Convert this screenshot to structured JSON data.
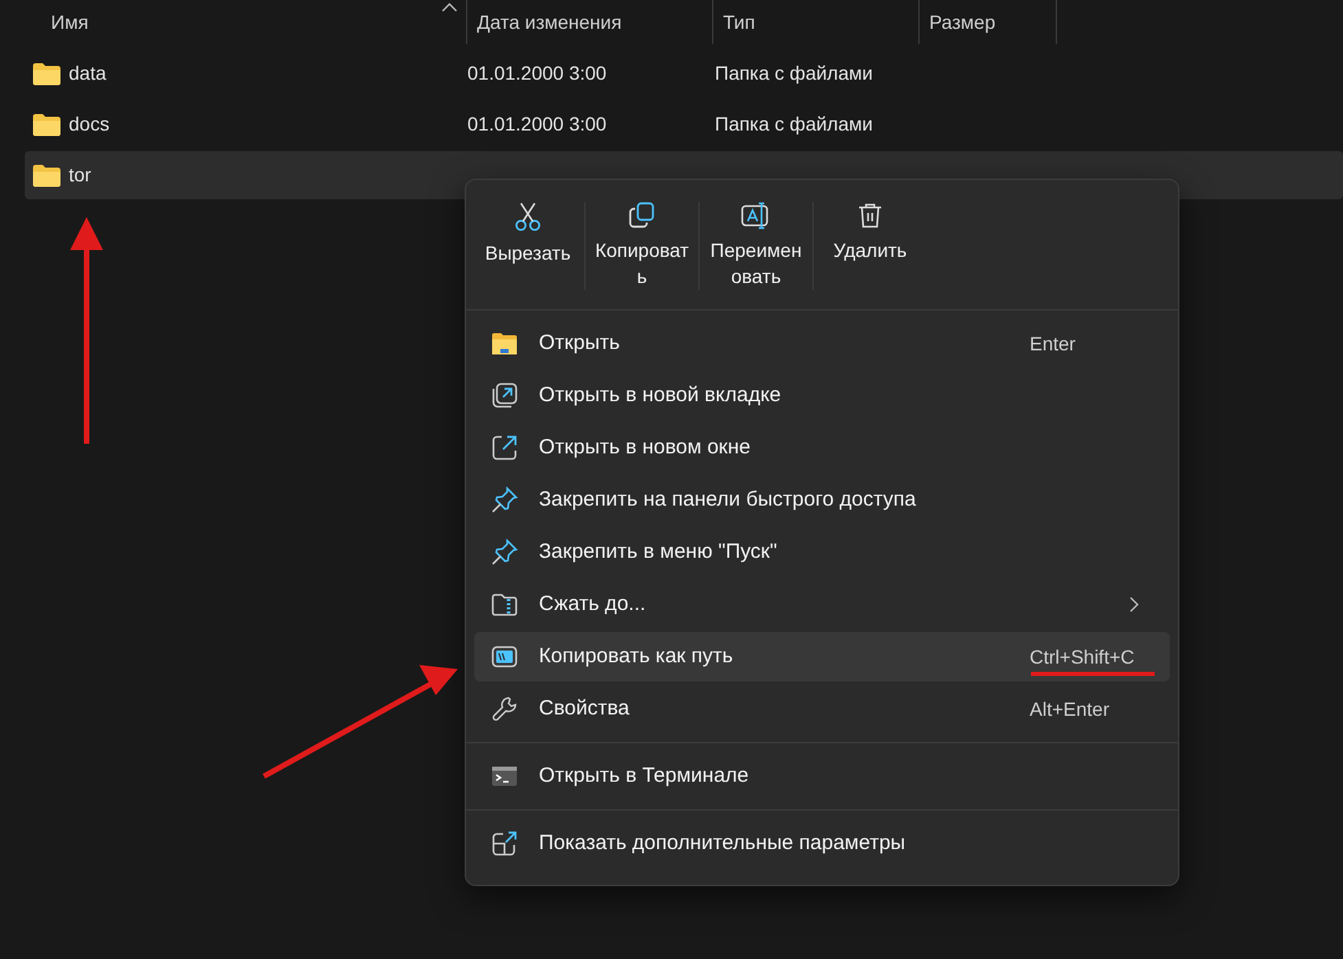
{
  "file_list": {
    "columns": [
      {
        "label": "Имя",
        "sorted": true
      },
      {
        "label": "Дата изменения",
        "sorted": false
      },
      {
        "label": "Тип",
        "sorted": false
      },
      {
        "label": "Размер",
        "sorted": false
      }
    ],
    "rows": [
      {
        "name": "data",
        "modified": "01.01.2000 3:00",
        "type": "Папка с файлами",
        "selected": false
      },
      {
        "name": "docs",
        "modified": "01.01.2000 3:00",
        "type": "Папка с файлами",
        "selected": false
      },
      {
        "name": "tor",
        "selected": true
      }
    ]
  },
  "context_menu": {
    "toolbar": [
      {
        "label": "Вырезать"
      },
      {
        "label": "Копировать"
      },
      {
        "label": "Переименовать"
      },
      {
        "label": "Удалить"
      }
    ],
    "sections": [
      [
        {
          "label": "Открыть",
          "shortcut": "Enter",
          "selected": false,
          "submenu": false,
          "underlined": false
        },
        {
          "label": "Открыть в новой вкладке",
          "selected": false,
          "submenu": false,
          "underlined": false
        },
        {
          "label": "Открыть в новом окне",
          "selected": false,
          "submenu": false,
          "underlined": false
        },
        {
          "label": "Закрепить на панели быстрого доступа",
          "selected": false,
          "submenu": false,
          "underlined": false
        },
        {
          "label": "Закрепить в меню \"Пуск\"",
          "selected": false,
          "submenu": false,
          "underlined": false
        },
        {
          "label": "Сжать до...",
          "selected": false,
          "submenu": true,
          "underlined": false
        },
        {
          "label": "Копировать как путь",
          "shortcut": "Ctrl+Shift+C",
          "selected": true,
          "submenu": false,
          "underlined": true
        },
        {
          "label": "Свойства",
          "shortcut": "Alt+Enter",
          "selected": false,
          "submenu": false,
          "underlined": false
        }
      ],
      [
        {
          "label": "Открыть в Терминале",
          "selected": false,
          "submenu": false,
          "underlined": false
        }
      ],
      [
        {
          "label": "Показать дополнительные параметры",
          "selected": false,
          "submenu": false,
          "underlined": false
        }
      ]
    ]
  }
}
